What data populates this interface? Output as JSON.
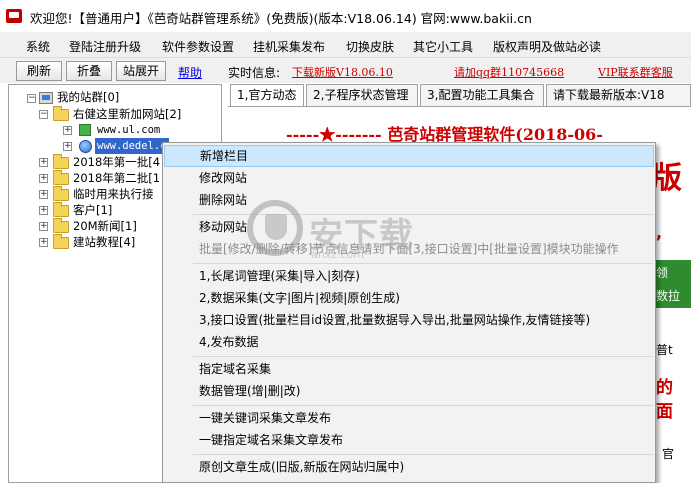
{
  "window": {
    "title": "欢迎您!【普通用户】《芭奇站群管理系统》(免费版)(版本:V18.06.14) 官网:www.bakii.cn"
  },
  "menu": [
    "系统",
    "登陆注册升级",
    "软件参数设置",
    "挂机采集发布",
    "切换皮肤",
    "其它小工具",
    "版权声明及做站必读"
  ],
  "toolbar": {
    "buttons": [
      "刷新",
      "折叠",
      "站展开"
    ],
    "help_link": "帮助",
    "info_label": "实时信息:",
    "info_links": [
      "下载新版V18.06.10",
      "请加qq群110745668",
      "VIP联系群客服"
    ]
  },
  "tree": {
    "root": "我的站群[0]",
    "group": "右健这里新加网站[2]",
    "sites": [
      "www.ul.com",
      "www.dedel.c"
    ],
    "folders": [
      "2018年第一批[4",
      "2018年第二批[1",
      "临时用来执行接",
      "客户[1]",
      "20M新闻[1]",
      "建站教程[4]"
    ]
  },
  "tabs": [
    "1,官方动态",
    "2,子程序状态管理",
    "3,配置功能工具集合",
    "请下载最新版本:V18"
  ],
  "content": {
    "banner": "-----★-------  芭奇站群管理软件(2018-06-",
    "side_fragments": [
      "版",
      ",",
      "领",
      "数拉",
      "普t",
      "的",
      "面",
      "官"
    ]
  },
  "context_menu": {
    "items": [
      {
        "label": "新增栏目",
        "highlighted": true
      },
      {
        "label": "修改网站"
      },
      {
        "label": "删除网站"
      },
      {
        "label": "移动网站"
      },
      {
        "label": "批量[修改/删除/转移]节点信息请到下面[3,接口设置]中[批量设置]模块功能操作",
        "disabled": true
      },
      {
        "label": "1,长尾词管理(采集|导入|刻存)"
      },
      {
        "label": "2,数据采集(文字|图片|视频|原创生成)"
      },
      {
        "label": "3,接口设置(批量栏目id设置,批量数据导入导出,批量网站操作,友情链接等)"
      },
      {
        "label": "4,发布数据"
      },
      {
        "label": "指定域名采集"
      },
      {
        "label": "数据管理(增|删|改)"
      },
      {
        "label": "一键关键词采集文章发布"
      },
      {
        "label": "一键指定域名采集文章发布"
      },
      {
        "label": "原创文章生成(旧版,新版在网站归属中)"
      }
    ]
  },
  "watermark": {
    "text": "安下载",
    "sub": "anxz.com"
  },
  "colors": {
    "menu_highlight": "#cce8ff",
    "selection": "#3366cc",
    "banner_red": "#cc0000",
    "link_red": "#cc0000"
  }
}
